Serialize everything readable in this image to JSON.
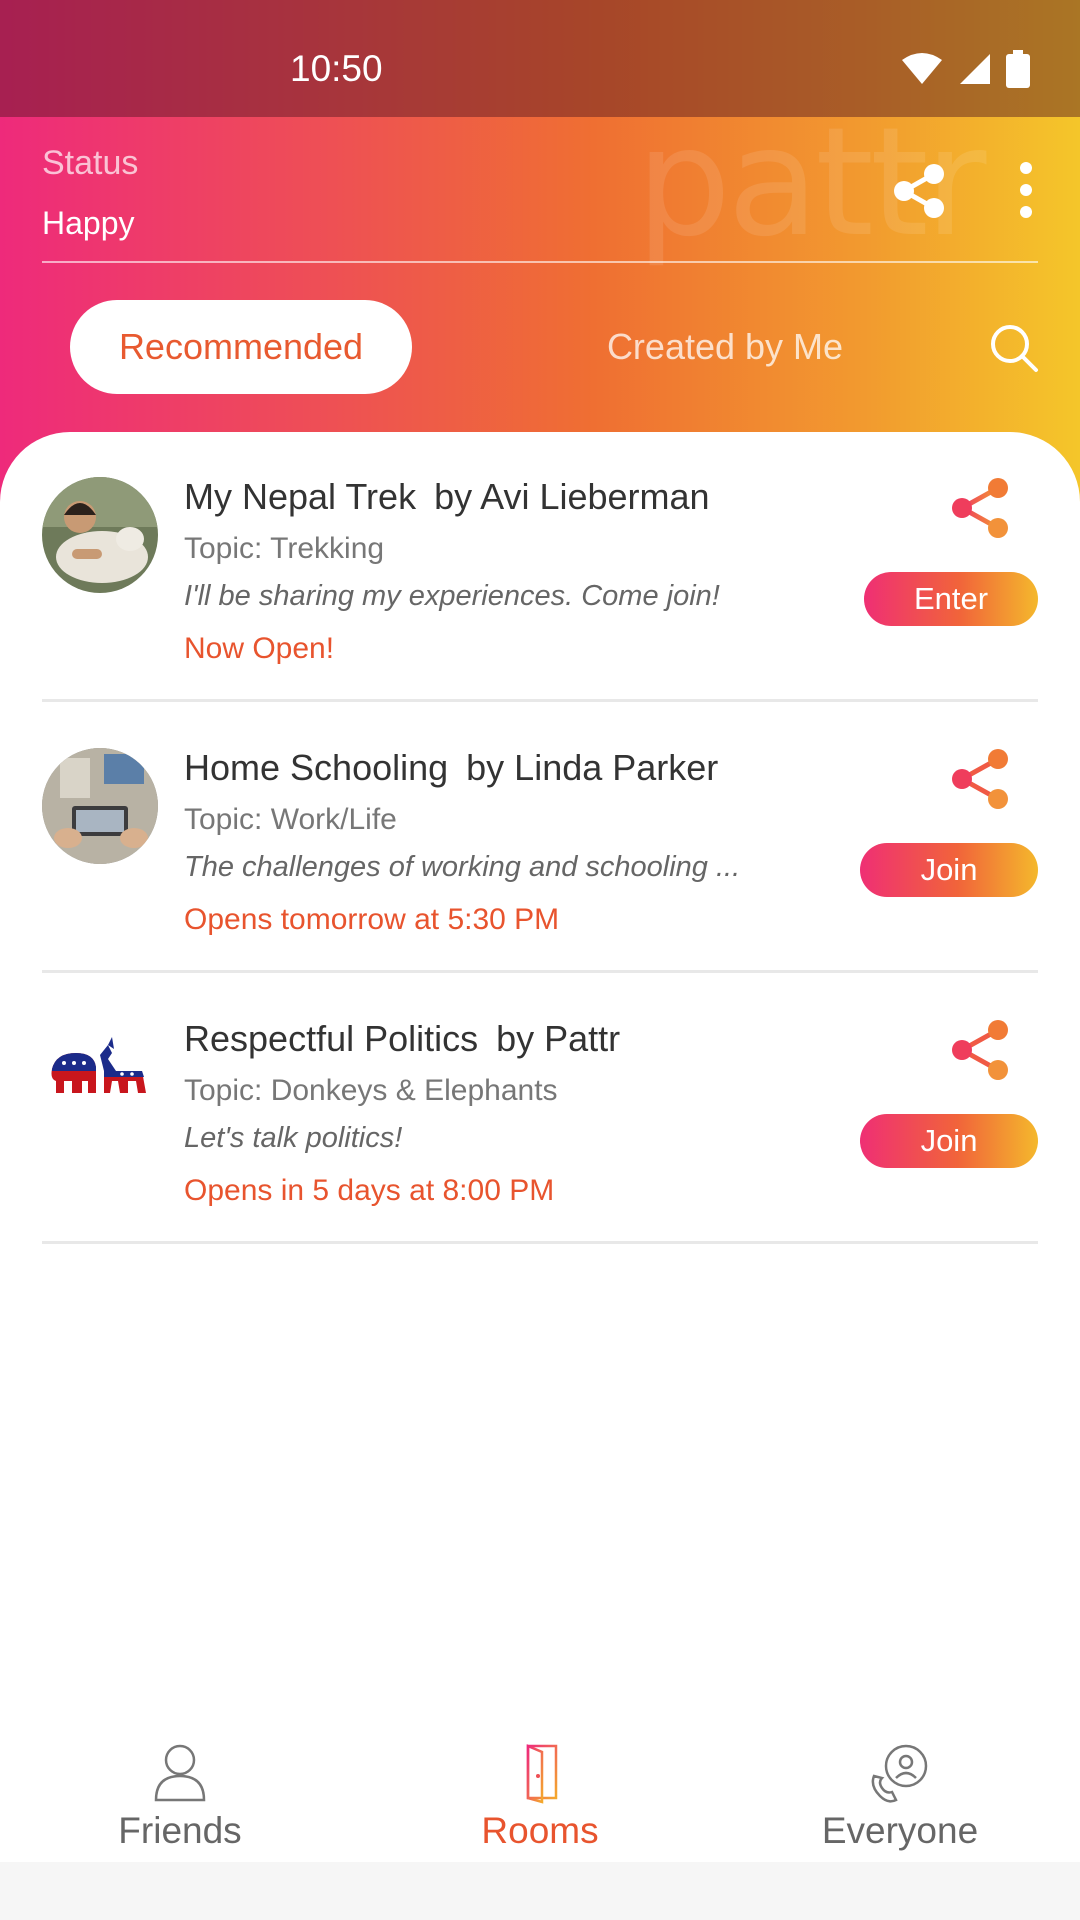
{
  "status_bar": {
    "time": "10:50"
  },
  "header": {
    "watermark": "pattr",
    "status_label": "Status",
    "status_value": "Happy",
    "tabs": [
      {
        "label": "Recommended",
        "active": true
      },
      {
        "label": "Created by Me",
        "active": false
      }
    ]
  },
  "rooms": [
    {
      "title": "My Nepal Trek",
      "by": "by Avi Lieberman",
      "topic": "Topic: Trekking",
      "description": "I'll be sharing my experiences. Come join!",
      "when": "Now Open!",
      "action": "Enter",
      "avatar": "avatar-child-with-lamb"
    },
    {
      "title": "Home Schooling",
      "by": "by Linda Parker",
      "topic": "Topic: Work/Life",
      "description": "The challenges of working and schooling ...",
      "when": "Opens tomorrow at 5:30 PM",
      "action": "Join",
      "avatar": "avatar-laptop"
    },
    {
      "title": "Respectful Politics",
      "by": "by Pattr",
      "topic": "Topic: Donkeys & Elephants",
      "description": "Let's talk politics!",
      "when": "Opens in 5 days at 8:00 PM",
      "action": "Join",
      "avatar": "avatar-elephant-donkey"
    }
  ],
  "bottom_nav": [
    {
      "label": "Friends",
      "icon": "person-icon",
      "active": false
    },
    {
      "label": "Rooms",
      "icon": "door-icon",
      "active": true
    },
    {
      "label": "Everyone",
      "icon": "phone-person-icon",
      "active": false
    }
  ],
  "colors": {
    "accent": "#e8542e",
    "gradient_start": "#ee2a7b",
    "gradient_end": "#f4c62a"
  }
}
